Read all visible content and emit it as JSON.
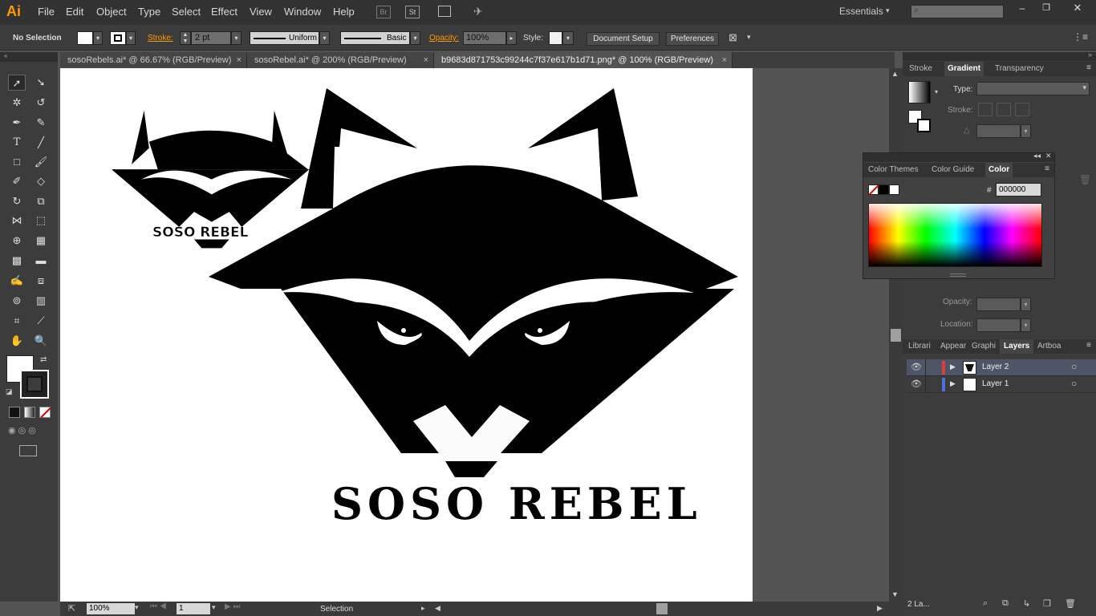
{
  "app": {
    "logo": "Ai"
  },
  "menu": [
    "File",
    "Edit",
    "Object",
    "Type",
    "Select",
    "Effect",
    "View",
    "Window",
    "Help"
  ],
  "menu_icons": {
    "br": "Br",
    "st": "St"
  },
  "workspace": "Essentials",
  "control": {
    "selection": "No Selection",
    "stroke_label": "Stroke:",
    "stroke_value": "2 pt",
    "profile": "Uniform",
    "brush": "Basic",
    "opacity_label": "Opacity:",
    "opacity_value": "100%",
    "style_label": "Style:",
    "doc_setup": "Document Setup",
    "preferences": "Preferences"
  },
  "tabs": [
    {
      "label": "sosoRebels.ai* @ 66.67% (RGB/Preview)"
    },
    {
      "label": "sosoRebel.ai* @ 200% (RGB/Preview)"
    },
    {
      "label": "b9683d871753c99244c7f37e617b1d71.png* @ 100% (RGB/Preview)"
    }
  ],
  "artwork": {
    "logo_small_text": "SOSO REBEL",
    "logo_big_text": "SOSO REBEL"
  },
  "status": {
    "zoom": "100%",
    "page": "1",
    "tool": "Selection"
  },
  "gradient_panel": {
    "tabs": [
      "Stroke",
      "Gradient",
      "Transparency"
    ],
    "type_label": "Type:",
    "stroke_label": "Stroke:",
    "opacity_label": "Opacity:",
    "location_label": "Location:"
  },
  "color_panel": {
    "tabs": [
      "Color Themes",
      "Color Guide",
      "Color"
    ],
    "hash": "#",
    "hex": "000000"
  },
  "layers_panel": {
    "tabs": [
      "Librari",
      "Appear",
      "Graphi",
      "Layers",
      "Artboa"
    ],
    "layers": [
      {
        "name": "Layer 2",
        "color": "#d93f3f"
      },
      {
        "name": "Layer 1",
        "color": "#4a6fd9"
      }
    ],
    "count": "2 La..."
  },
  "colors": {
    "accent": "#ff9a00"
  }
}
